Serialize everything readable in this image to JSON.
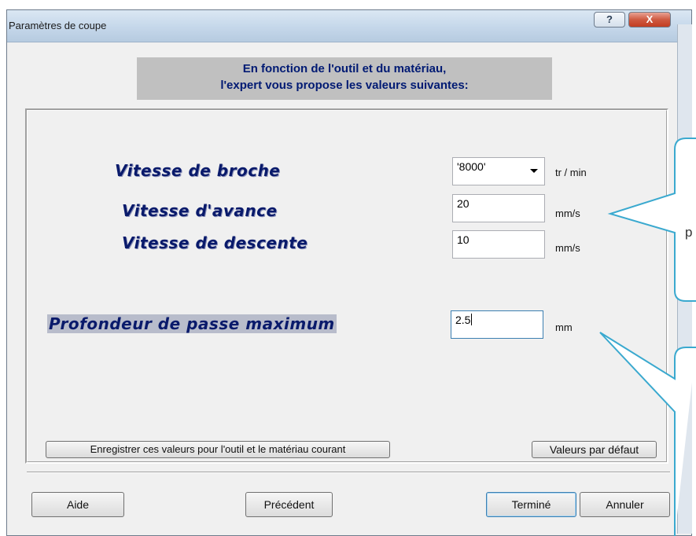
{
  "window": {
    "title": "Paramètres de coupe",
    "help_glyph": "?",
    "close_glyph": "X"
  },
  "header": {
    "line1": "En fonction de l'outil et du matériau,",
    "line2": "l'expert vous propose les valeurs suivantes:"
  },
  "fields": {
    "spindle_speed": {
      "label": "Vitesse de broche",
      "value": "'8000'",
      "unit": "tr / min"
    },
    "feed_speed": {
      "label": "Vitesse d'avance",
      "value": "20",
      "unit": "mm/s"
    },
    "descent_speed": {
      "label": "Vitesse de descente",
      "value": "10",
      "unit": "mm/s"
    },
    "max_depth": {
      "label": "Profondeur de passe maximum",
      "value": "2.5",
      "unit": "mm"
    }
  },
  "group_buttons": {
    "save": "Enregistrer ces valeurs pour l'outil et le matériau courant",
    "defaults": "Valeurs par défaut"
  },
  "footer": {
    "help": "Aide",
    "previous": "Précédent",
    "finish": "Terminé",
    "cancel": "Annuler"
  },
  "callout": {
    "visible_text": "p"
  },
  "colors": {
    "label_text": "#091a6b",
    "banner_bg": "#c0c0c0",
    "callout_border": "#3aa9cf",
    "default_button_border": "#3c7fb1"
  }
}
